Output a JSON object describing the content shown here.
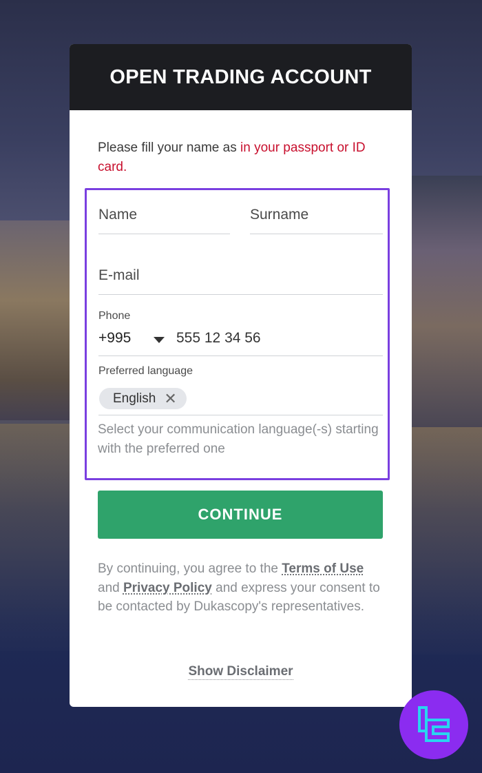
{
  "form": {
    "title": "OPEN TRADING ACCOUNT",
    "intro_plain": "Please fill your name as ",
    "intro_highlight": "in your passport or ID card",
    "intro_end": ".",
    "name_placeholder": "Name",
    "surname_placeholder": "Surname",
    "email_placeholder": "E-mail",
    "phone_label": "Phone",
    "phone_code": "+995",
    "phone_number": "555 12 34 56",
    "language_label": "Preferred language",
    "language_chip": "English",
    "language_hint": "Select your communication language(-s) starting with the preferred one",
    "continue_label": "CONTINUE",
    "terms_1": "By continuing, you agree to the ",
    "terms_link": "Terms of Use",
    "terms_2": " and ",
    "privacy_link": "Privacy Policy",
    "terms_3": " and express your consent to be contacted by Dukascopy's representatives.",
    "disclaimer_link": "Show Disclaimer"
  },
  "colors": {
    "header_bg": "#1c1d21",
    "accent_red": "#c8102e",
    "button_green": "#2fa36b",
    "highlight_border": "#7a3fe0",
    "badge_purple": "#8b2cf0"
  },
  "icons": {
    "chip_remove": "close-icon",
    "phone_dropdown": "caret-down-icon",
    "badge": "brand-logo-icon"
  }
}
